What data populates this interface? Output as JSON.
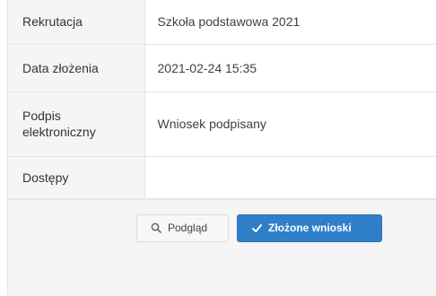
{
  "details": {
    "rows": [
      {
        "label": "Rekrutacja",
        "value": "Szkoła podstawowa 2021"
      },
      {
        "label": "Data złożenia",
        "value": "2021-02-24 15:35"
      },
      {
        "label": "Podpis elektroniczny",
        "value": "Wniosek podpisany"
      },
      {
        "label": "Dostępy",
        "value": ""
      }
    ]
  },
  "actions": {
    "preview_label": "Podgląd",
    "preview_icon": "search-icon",
    "submitted_label": "Złożone wnioski",
    "submitted_icon": "check-icon"
  },
  "colors": {
    "primary": "#2f7fc9",
    "label_bg": "#f5f5f5",
    "border": "#e6e6e6"
  }
}
